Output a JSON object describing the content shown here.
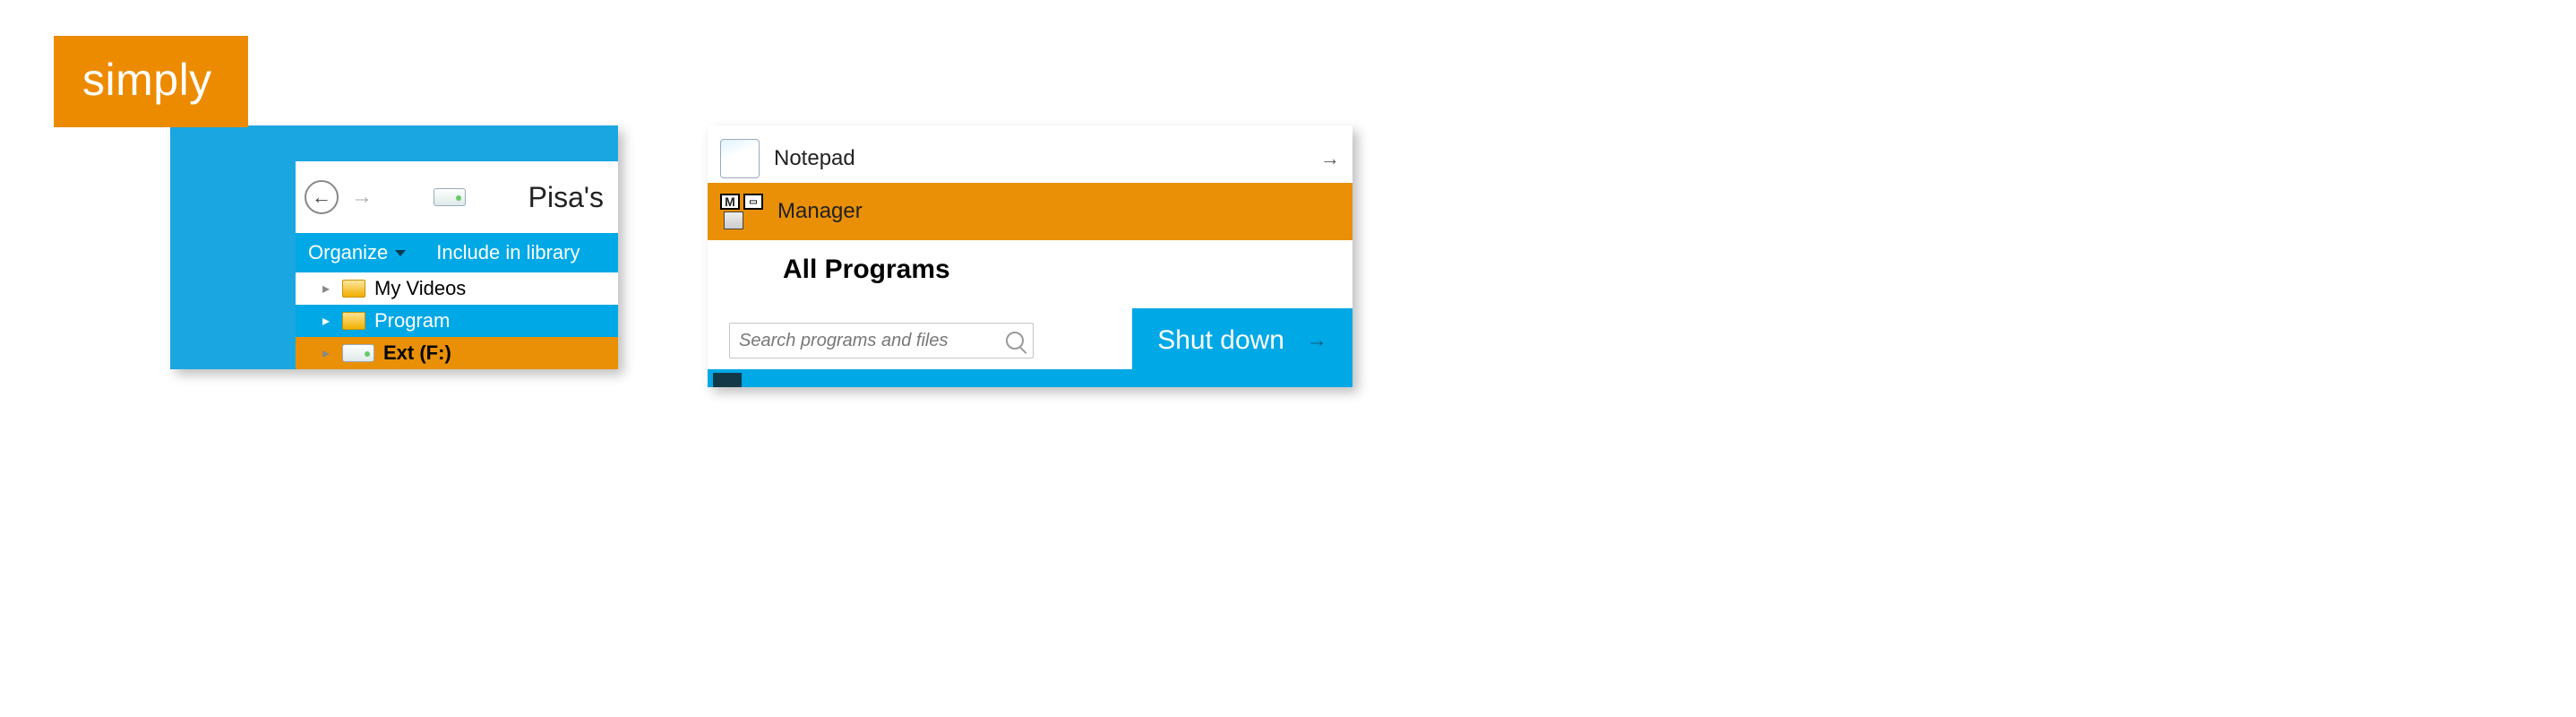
{
  "badge": {
    "text": "simply"
  },
  "explorer": {
    "address": "Pisa's",
    "toolbar": {
      "organize": "Organize",
      "include": "Include in library"
    },
    "tree": [
      {
        "label": "My Videos",
        "kind": "folder",
        "selected": false
      },
      {
        "label": "Program",
        "kind": "folder",
        "selected": true
      },
      {
        "label": "Ext (F:)",
        "kind": "drive",
        "selected": false
      }
    ]
  },
  "startmenu": {
    "items": [
      {
        "label": "Notepad",
        "hasArrow": true,
        "highlight": false
      },
      {
        "label": "Manager",
        "hasArrow": false,
        "highlight": true
      }
    ],
    "allPrograms": "All Programs",
    "searchPlaceholder": "Search programs and files",
    "shutdown": "Shut down"
  }
}
